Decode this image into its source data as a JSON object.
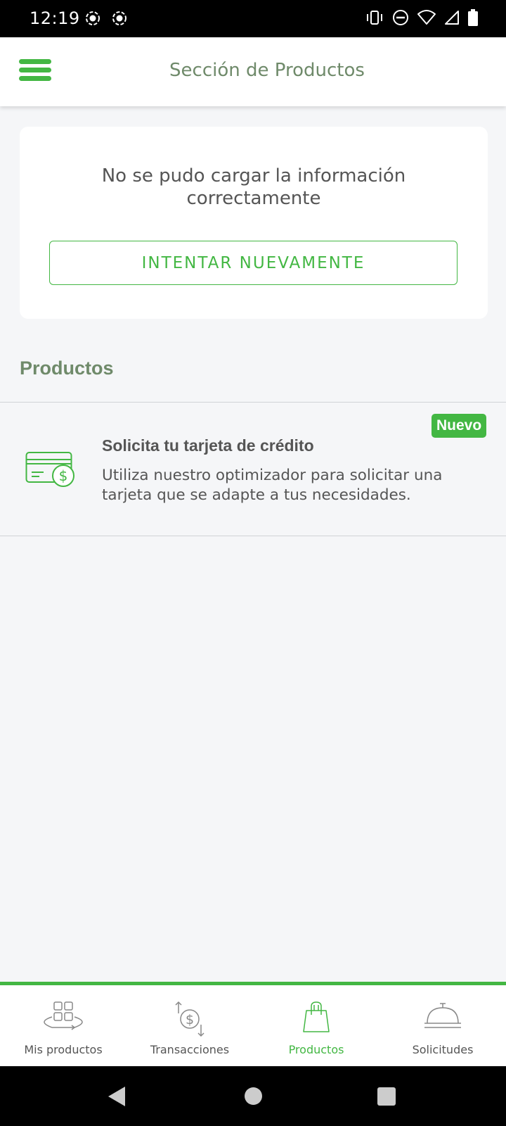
{
  "status_bar": {
    "time": "12:19"
  },
  "header": {
    "title": "Sección de Productos"
  },
  "error_card": {
    "message": "No se pudo cargar la información correctamente",
    "retry_label": "INTENTAR NUEVAMENTE"
  },
  "products_section": {
    "title": "Productos",
    "items": [
      {
        "badge": "Nuevo",
        "title": "Solicita tu tarjeta de crédito",
        "description": "Utiliza nuestro optimizador para solicitar una tarjeta que se adapte a tus necesidades.",
        "icon": "credit-card-dollar-icon"
      }
    ]
  },
  "bottom_nav": {
    "items": [
      {
        "label": "Mis productos",
        "icon": "grid-products-icon",
        "active": false
      },
      {
        "label": "Transacciones",
        "icon": "dollar-transfer-icon",
        "active": false
      },
      {
        "label": "Productos",
        "icon": "shopping-bag-icon",
        "active": true
      },
      {
        "label": "Solicitudes",
        "icon": "service-bell-icon",
        "active": false
      }
    ]
  },
  "colors": {
    "accent": "#43b743",
    "title_green": "#6f8a6a",
    "background": "#f5f6f8",
    "text": "#555555"
  }
}
